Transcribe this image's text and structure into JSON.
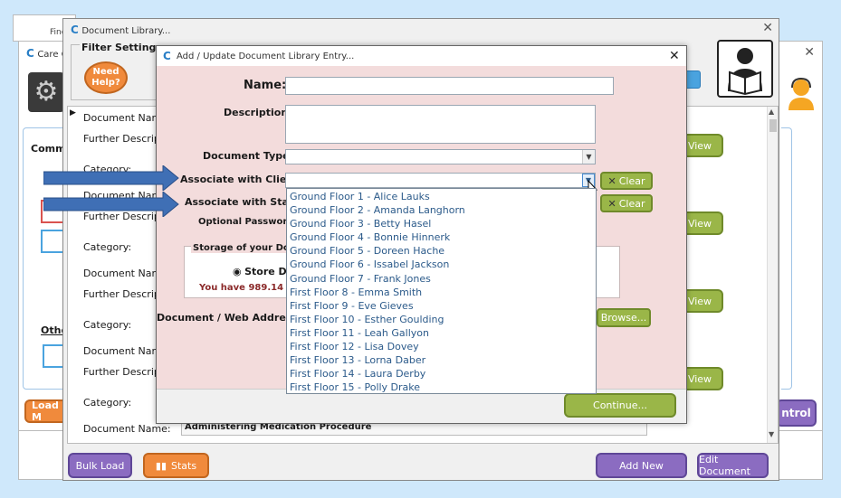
{
  "bg_app": {
    "find_label": "Find",
    "care_title": "Care C",
    "common_label": "Commo",
    "other_label": "Othe",
    "load_button": "Load M",
    "control_button": "ntrol"
  },
  "library_window": {
    "title": "Document Library...",
    "filter_title": "Filter Settings",
    "need_help": "Need Help?",
    "entries": [
      {
        "name_label": "Document Name:",
        "desc_label": "Further Descriptio",
        "cat_label": "Category:",
        "view_label": "View"
      },
      {
        "name_label": "Document Name:",
        "desc_label": "Further Descriptio",
        "cat_label": "Category:",
        "view_label": "View"
      },
      {
        "name_label": "Document Name:",
        "desc_label": "Further Descriptio",
        "cat_label": "Category:",
        "view_label": "View"
      },
      {
        "name_label": "Document Name:",
        "desc_label": "Further Descriptio",
        "cat_label": "Category:",
        "view_label": "View"
      }
    ],
    "last_entry_label": "Document Name:",
    "last_entry_value": "Administering Medication Procedure",
    "bulk_load": "Bulk Load",
    "stats": "Stats",
    "add_new": "Add New",
    "edit_document": "Edit Document"
  },
  "dialog": {
    "title": "Add / Update Document Library Entry...",
    "name_label": "Name:",
    "name_value": "",
    "description_label": "Description:",
    "description_value": "",
    "document_type_label": "Document Type:",
    "document_type_value": "",
    "client_label": "Associate with Client:",
    "client_value": "",
    "staff_label": "Associate with Staff:",
    "password_label": "Optional Password:",
    "clear_label": "Clear",
    "storage_label": "Storage of your Docum",
    "store_option": "Store Doc",
    "storage_info": "You have 989.14 MB",
    "address_label": "Document / Web Address:",
    "browse": "Browse...",
    "continue": "Continue...",
    "client_options": [
      "Ground Floor 1 - Alice Lauks",
      "Ground Floor 2 - Amanda Langhorn",
      "Ground Floor 3 - Betty Hasel",
      "Ground Floor 4 - Bonnie Hinnerk",
      "Ground Floor 5 - Doreen Hache",
      "Ground Floor 6 - Issabel Jackson",
      "Ground Floor 7 - Frank Jones",
      "First Floor 8 - Emma Smith",
      "First Floor 9 - Eve Gieves",
      "First Floor 10 - Esther Goulding",
      "First Floor 11 - Leah Gallyon",
      "First Floor 12 - Lisa Dovey",
      "First Floor 13 - Lorna Daber",
      "First Floor 14 - Laura Derby",
      "First Floor 15 - Polly Drake"
    ]
  },
  "colors": {
    "dialog_bg": "#f3dcdc",
    "accent_green": "#9ab648",
    "accent_purple": "#8b6cc1",
    "accent_orange": "#f08a3c",
    "arrow_blue": "#3f6fb5",
    "dropdown_text": "#2b5a8a"
  }
}
